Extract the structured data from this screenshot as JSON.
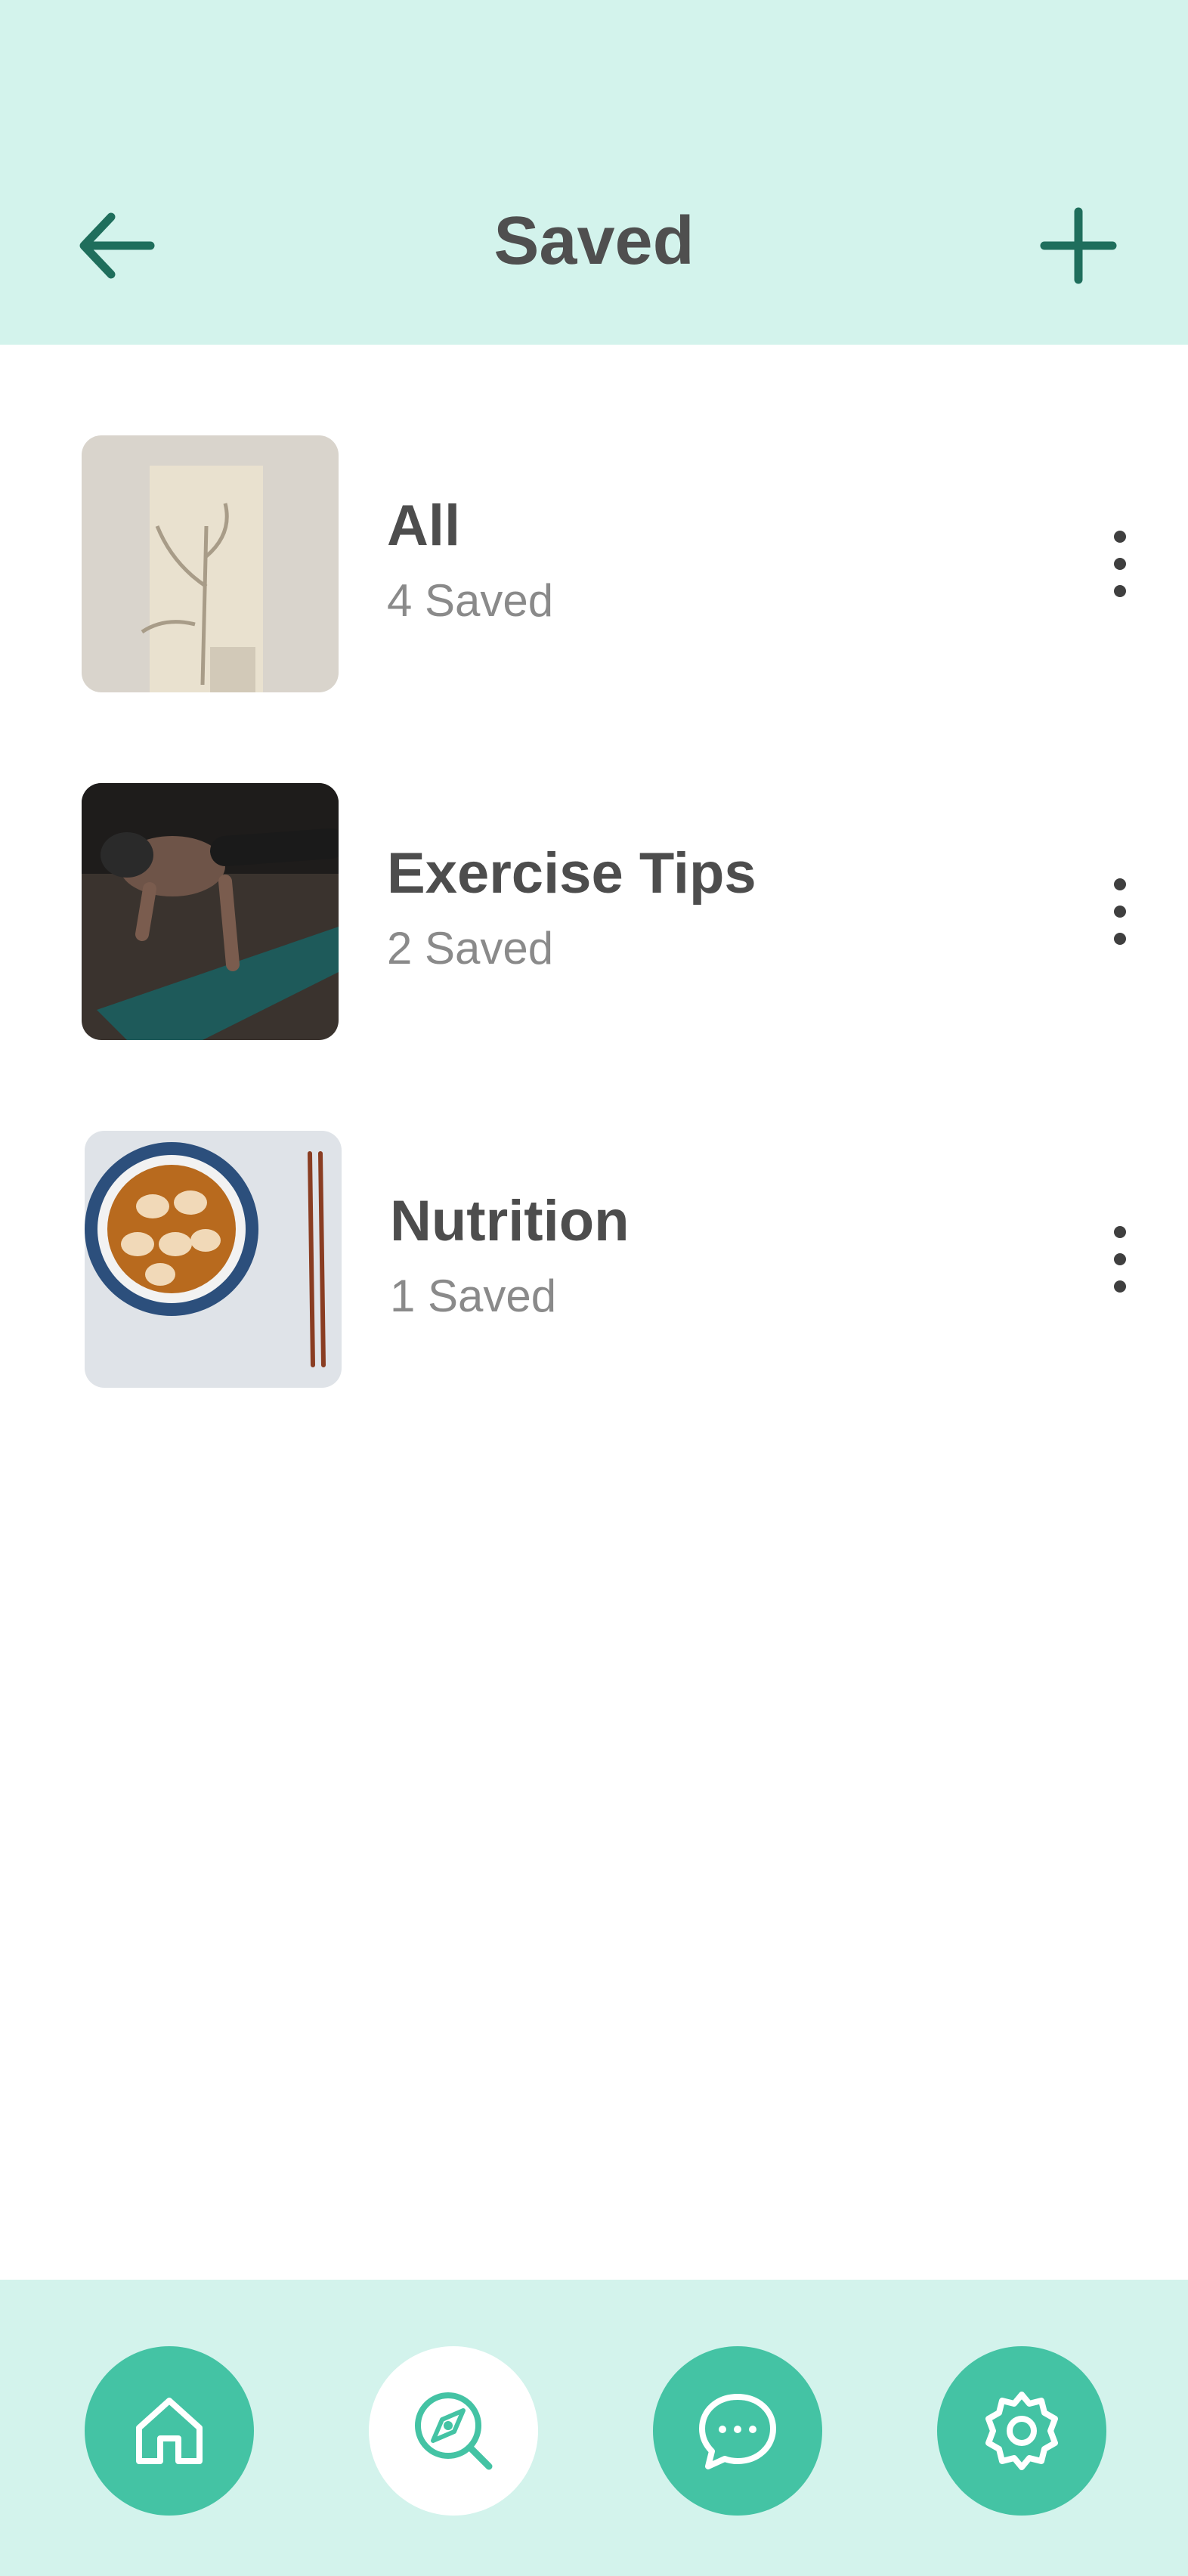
{
  "header": {
    "title": "Saved",
    "back_icon": "arrow-left-icon",
    "add_icon": "plus-icon",
    "icon_color": "#1f6e5c",
    "background": "#d3f3ec"
  },
  "collections": [
    {
      "title": "All",
      "count_label": "4 Saved",
      "thumbnail": "plant-shadow-photo",
      "menu_icon": "more-vertical-icon"
    },
    {
      "title": "Exercise Tips",
      "count_label": "2 Saved",
      "thumbnail": "pushup-yoga-mat-photo",
      "menu_icon": "more-vertical-icon"
    },
    {
      "title": "Nutrition",
      "count_label": "1 Saved",
      "thumbnail": "dumpling-soup-photo",
      "menu_icon": "more-vertical-icon"
    }
  ],
  "tabbar": {
    "tabs": [
      {
        "name": "home",
        "icon": "home-icon",
        "active": false
      },
      {
        "name": "discover",
        "icon": "search-compass-icon",
        "active": true
      },
      {
        "name": "messages",
        "icon": "chat-bubble-icon",
        "active": false
      },
      {
        "name": "settings",
        "icon": "gear-icon",
        "active": false
      }
    ],
    "accent": "#44c3a4",
    "background": "#d3f3ec"
  }
}
